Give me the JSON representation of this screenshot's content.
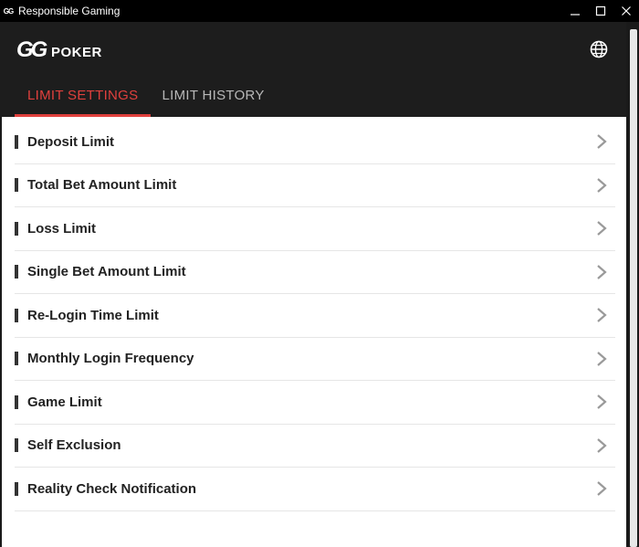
{
  "window": {
    "title": "Responsible Gaming",
    "app_icon_text": "GG"
  },
  "header": {
    "logo_gg": "GG",
    "logo_poker": "POKER"
  },
  "tabs": [
    {
      "label": "LIMIT SETTINGS",
      "active": true
    },
    {
      "label": "LIMIT HISTORY",
      "active": false
    }
  ],
  "items": [
    {
      "label": "Deposit Limit"
    },
    {
      "label": "Total Bet Amount Limit"
    },
    {
      "label": "Loss Limit"
    },
    {
      "label": "Single Bet Amount Limit"
    },
    {
      "label": "Re-Login Time Limit"
    },
    {
      "label": "Monthly Login Frequency"
    },
    {
      "label": "Game Limit"
    },
    {
      "label": "Self Exclusion"
    },
    {
      "label": "Reality Check Notification"
    }
  ],
  "icons": {
    "globe": "globe-icon",
    "chevron": "chevron-right-icon",
    "minimize": "minimize-icon",
    "maximize": "maximize-icon",
    "close": "close-icon"
  },
  "colors": {
    "accent": "#e0403d",
    "header_bg": "#1d1d1d",
    "titlebar_bg": "#000000",
    "item_text": "#222222",
    "chevron": "#999999"
  }
}
